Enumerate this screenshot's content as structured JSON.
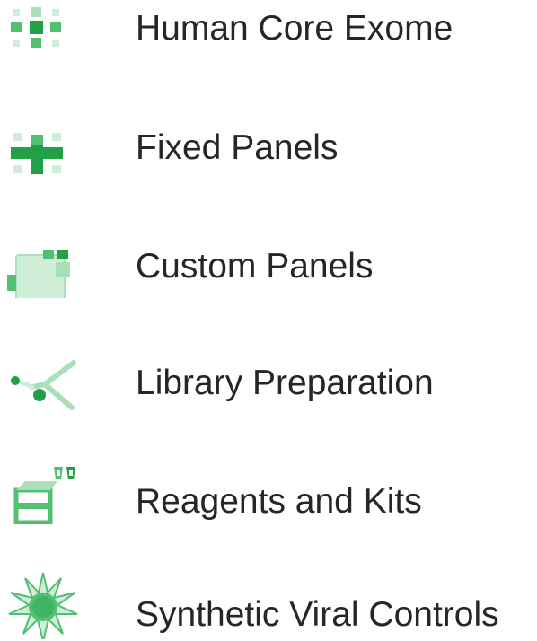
{
  "colors": {
    "green_dark": "#21a046",
    "green_mid": "#52bf72",
    "green_light": "#a9dfb9",
    "green_pale": "#cfeed8",
    "text": "#262626"
  },
  "items": [
    {
      "label": "Human Core Exome",
      "icon": "exome-grid-icon"
    },
    {
      "label": "Fixed Panels",
      "icon": "fixed-panels-cross-icon"
    },
    {
      "label": "Custom Panels",
      "icon": "custom-panels-blocks-icon"
    },
    {
      "label": "Library Preparation",
      "icon": "library-prep-fork-icon"
    },
    {
      "label": "Reagents and Kits",
      "icon": "reagents-kit-box-icon"
    },
    {
      "label": "Synthetic Viral Controls",
      "icon": "viral-controls-burst-icon"
    }
  ]
}
